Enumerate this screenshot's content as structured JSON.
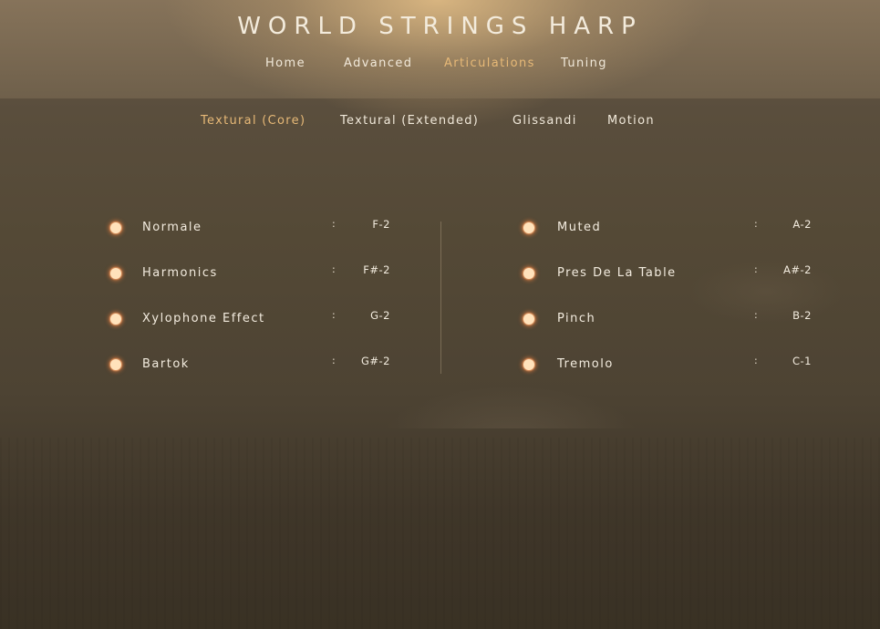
{
  "app": {
    "title": "WORLD STRINGS HARP"
  },
  "main_tabs": [
    {
      "label": "Home",
      "active": false
    },
    {
      "label": "Advanced",
      "active": false
    },
    {
      "label": "Articulations",
      "active": true
    },
    {
      "label": "Tuning",
      "active": false
    }
  ],
  "sub_tabs": [
    {
      "label": "Textural (Core)",
      "active": true
    },
    {
      "label": "Textural (Extended)",
      "active": false
    },
    {
      "label": "Glissandi",
      "active": false
    },
    {
      "label": "Motion",
      "active": false
    }
  ],
  "articulations": {
    "left": [
      {
        "label": "Normale",
        "separator": ":",
        "key": "F-2"
      },
      {
        "label": "Harmonics",
        "separator": ":",
        "key": "F#-2"
      },
      {
        "label": "Xylophone Effect",
        "separator": ":",
        "key": "G-2"
      },
      {
        "label": "Bartok",
        "separator": ":",
        "key": "G#-2"
      }
    ],
    "right": [
      {
        "label": "Muted",
        "separator": ":",
        "key": "A-2"
      },
      {
        "label": "Pres De La Table",
        "separator": ":",
        "key": "A#-2"
      },
      {
        "label": "Pinch",
        "separator": ":",
        "key": "B-2"
      },
      {
        "label": "Tremolo",
        "separator": ":",
        "key": "C-1"
      }
    ]
  },
  "colors": {
    "accent": "#e7b977",
    "text": "#f3ecdf",
    "indicator": "#ffe2bb",
    "background": "#54493a"
  }
}
